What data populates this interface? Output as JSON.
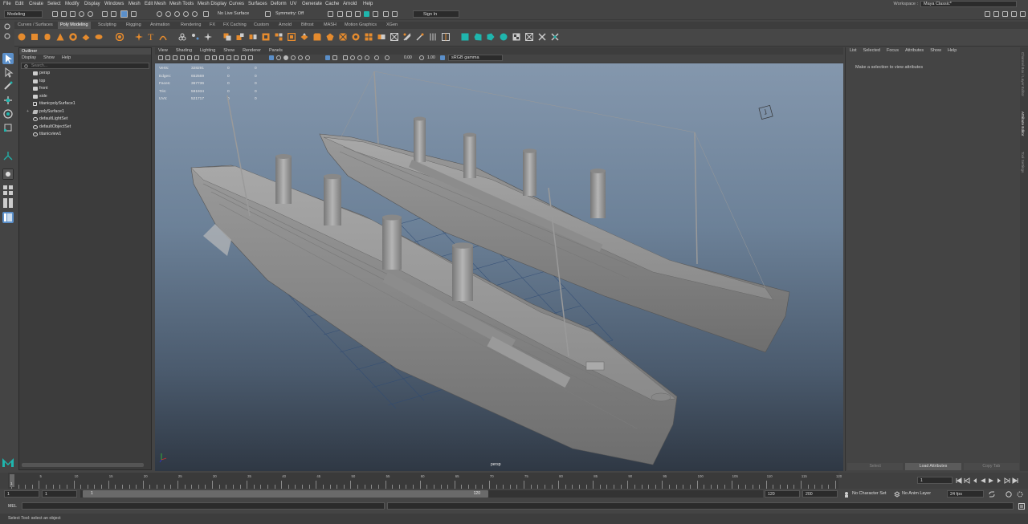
{
  "menubar": {
    "items": [
      "File",
      "Edit",
      "Create",
      "Select",
      "Modify",
      "Display",
      "Windows",
      "Mesh",
      "Edit Mesh",
      "Mesh Tools",
      "Mesh Display",
      "Curves",
      "Surfaces",
      "Deform",
      "UV",
      "Generate",
      "Cache",
      "Arnold",
      "Help"
    ],
    "workspace_label": "Workspace :",
    "workspace_value": "Maya Classic*"
  },
  "statusline": {
    "mode": "Modeling",
    "live_surface": "No Live Surface",
    "symmetry": "Symmetry: Off",
    "sign_in": "Sign In"
  },
  "shelf": {
    "tabs": [
      "Curves / Surfaces",
      "Poly Modeling",
      "Sculpting",
      "Rigging",
      "Animation",
      "Rendering",
      "FX",
      "FX Caching",
      "Custom",
      "Arnold",
      "Bifrost",
      "MASH",
      "Motion Graphics",
      "XGen"
    ],
    "active_tab": "Poly Modeling",
    "accent": "#e58b2e"
  },
  "outliner": {
    "title": "Outliner",
    "menu": [
      "Display",
      "Show",
      "Help"
    ],
    "search_placeholder": "Search...",
    "items": [
      {
        "label": "persp",
        "icon": "camera-icon"
      },
      {
        "label": "top",
        "icon": "camera-icon"
      },
      {
        "label": "front",
        "icon": "camera-icon"
      },
      {
        "label": "side",
        "icon": "camera-icon"
      },
      {
        "label": "titanicpolySurface1",
        "icon": "transform-icon"
      },
      {
        "label": "polySurface1",
        "icon": "mesh-icon"
      },
      {
        "label": "defaultLightSet",
        "icon": "set-icon"
      },
      {
        "label": "defaultObjectSet",
        "icon": "set-icon"
      },
      {
        "label": "titanicview1",
        "icon": "set-icon"
      }
    ]
  },
  "viewport": {
    "menu": [
      "View",
      "Shading",
      "Lighting",
      "Show",
      "Renderer",
      "Panels"
    ],
    "exposure": "0.00",
    "gamma": "1.00",
    "color_space": "sRGB gamma",
    "camera": "persp",
    "hud": [
      {
        "label": "Verts:",
        "v1": "328291",
        "v2": "0",
        "v3": "0"
      },
      {
        "label": "Edges:",
        "v1": "652569",
        "v2": "0",
        "v3": "0"
      },
      {
        "label": "Faces:",
        "v1": "367736",
        "v2": "0",
        "v3": "0"
      },
      {
        "label": "Tris:",
        "v1": "591934",
        "v2": "0",
        "v3": "0"
      },
      {
        "label": "UVs:",
        "v1": "521717",
        "v2": "0",
        "v3": "0"
      }
    ]
  },
  "attribute_editor": {
    "menu": [
      "List",
      "Selected",
      "Focus",
      "Attributes",
      "Show",
      "Help"
    ],
    "message": "Make a selection to view attributes",
    "buttons": [
      "Select",
      "Load Attributes",
      "Copy Tab"
    ],
    "side_tabs": [
      "Channel Box / Layer Editor",
      "Attribute Editor",
      "Tool Settings"
    ]
  },
  "timeline": {
    "start": 1,
    "end": 120,
    "current_frame": "1",
    "tick_labels": [
      "1",
      "5",
      "10",
      "15",
      "20",
      "25",
      "30",
      "35",
      "40",
      "45",
      "50",
      "55",
      "60",
      "65",
      "70",
      "75",
      "80",
      "85",
      "90",
      "95",
      "100",
      "105",
      "110",
      "115",
      "120"
    ]
  },
  "range": {
    "start_field": "1",
    "start_field2": "1",
    "range_start": "1",
    "range_end": "120",
    "end_field": "120",
    "end_field2": "200",
    "character_set": "No Character Set",
    "anim_layer": "No Anim Layer",
    "fps": "24 fps"
  },
  "cmdline": {
    "label": "MEL"
  },
  "helpline": {
    "text": "Select Tool: select an object"
  },
  "colors": {
    "ui_bg": "#444444",
    "highlight_blue": "#5b8fc9",
    "maya_logo": "#1fb5ad"
  }
}
